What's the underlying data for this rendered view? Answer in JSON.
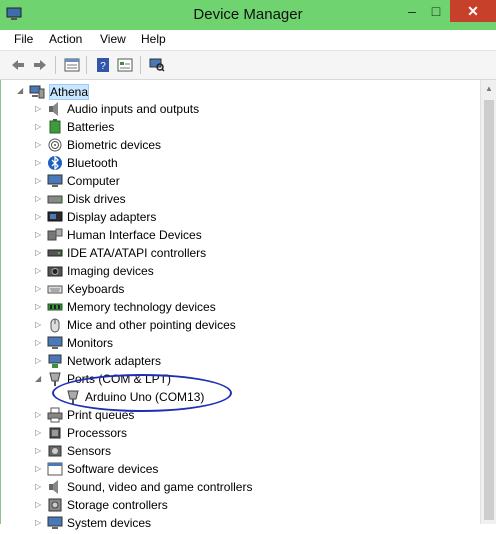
{
  "window": {
    "title": "Device Manager",
    "minimize": "–",
    "maximize": "□",
    "close": "✕"
  },
  "menu": [
    "File",
    "Action",
    "View",
    "Help"
  ],
  "toolbar_icons": [
    "back-arrow-icon",
    "forward-arrow-icon",
    "properties-icon",
    "help-icon",
    "show-hidden-icon",
    "scan-hardware-icon"
  ],
  "tree": {
    "root": {
      "label": "Athena",
      "expander": "◢",
      "icon": "computer-icon"
    },
    "items": [
      {
        "label": "Audio inputs and outputs",
        "expander": "▷",
        "icon": "speaker-icon"
      },
      {
        "label": "Batteries",
        "expander": "▷",
        "icon": "battery-icon"
      },
      {
        "label": "Biometric devices",
        "expander": "▷",
        "icon": "fingerprint-icon"
      },
      {
        "label": "Bluetooth",
        "expander": "▷",
        "icon": "bluetooth-icon"
      },
      {
        "label": "Computer",
        "expander": "▷",
        "icon": "monitor-icon"
      },
      {
        "label": "Disk drives",
        "expander": "▷",
        "icon": "disk-icon"
      },
      {
        "label": "Display adapters",
        "expander": "▷",
        "icon": "display-adapter-icon"
      },
      {
        "label": "Human Interface Devices",
        "expander": "▷",
        "icon": "hid-icon"
      },
      {
        "label": "IDE ATA/ATAPI controllers",
        "expander": "▷",
        "icon": "ide-icon"
      },
      {
        "label": "Imaging devices",
        "expander": "▷",
        "icon": "camera-icon"
      },
      {
        "label": "Keyboards",
        "expander": "▷",
        "icon": "keyboard-icon"
      },
      {
        "label": "Memory technology devices",
        "expander": "▷",
        "icon": "memory-icon"
      },
      {
        "label": "Mice and other pointing devices",
        "expander": "▷",
        "icon": "mouse-icon"
      },
      {
        "label": "Monitors",
        "expander": "▷",
        "icon": "monitor-icon"
      },
      {
        "label": "Network adapters",
        "expander": "▷",
        "icon": "network-icon"
      },
      {
        "label": "Ports (COM & LPT)",
        "expander": "◢",
        "icon": "port-icon"
      },
      {
        "label": "Arduino Uno (COM13)",
        "expander": "",
        "icon": "port-icon",
        "child": true
      },
      {
        "label": "Print queues",
        "expander": "▷",
        "icon": "printer-icon"
      },
      {
        "label": "Processors",
        "expander": "▷",
        "icon": "cpu-icon"
      },
      {
        "label": "Sensors",
        "expander": "▷",
        "icon": "sensor-icon"
      },
      {
        "label": "Software devices",
        "expander": "▷",
        "icon": "software-icon"
      },
      {
        "label": "Sound, video and game controllers",
        "expander": "▷",
        "icon": "speaker-icon"
      },
      {
        "label": "Storage controllers",
        "expander": "▷",
        "icon": "storage-icon"
      },
      {
        "label": "System devices",
        "expander": "▷",
        "icon": "monitor-icon"
      }
    ]
  }
}
